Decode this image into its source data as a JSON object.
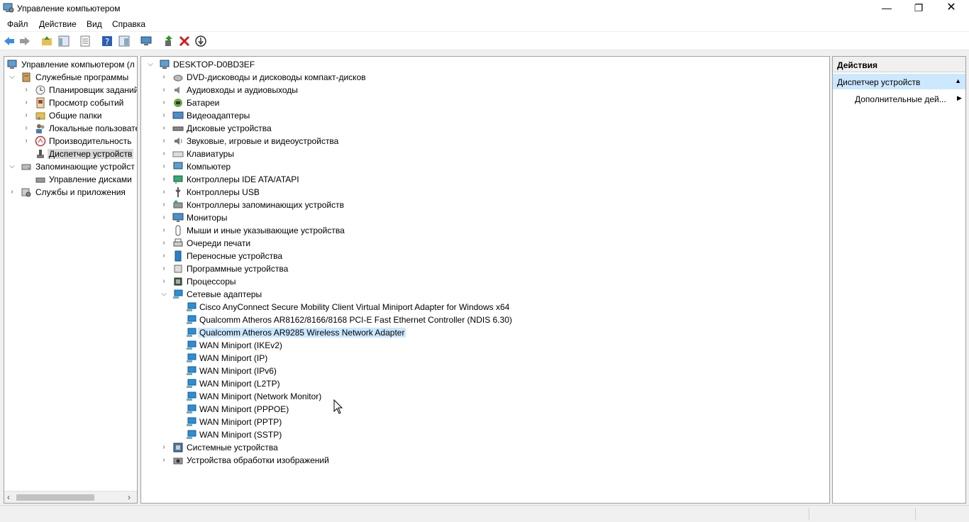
{
  "window": {
    "title": "Управление компьютером",
    "min_glyph": "—",
    "max_glyph": "❐",
    "close_glyph": "✕"
  },
  "menu": [
    "Файл",
    "Действие",
    "Вид",
    "Справка"
  ],
  "toolbar": [
    "back-arrow-icon",
    "forward-arrow-icon",
    "up-folder-icon",
    "show-hide-tree-icon",
    "properties-icon",
    "help-icon",
    "details-view-icon",
    "monitor-icon",
    "update-driver-icon",
    "uninstall-icon",
    "disable-device-icon"
  ],
  "left_tree": {
    "root": "Управление компьютером (л",
    "items": [
      {
        "label": "Служебные программы",
        "level": 1,
        "expanded": true
      },
      {
        "label": "Планировщик заданий",
        "level": 2
      },
      {
        "label": "Просмотр событий",
        "level": 2
      },
      {
        "label": "Общие папки",
        "level": 2
      },
      {
        "label": "Локальные пользовате",
        "level": 2
      },
      {
        "label": "Производительность",
        "level": 2
      },
      {
        "label": "Диспетчер устройств",
        "level": 2,
        "selected": true
      },
      {
        "label": "Запоминающие устройст",
        "level": 1,
        "expanded": true
      },
      {
        "label": "Управление дисками",
        "level": 2
      },
      {
        "label": "Службы и приложения",
        "level": 1
      }
    ]
  },
  "device_tree": {
    "root": "DESKTOP-D0BD3EF",
    "categories": [
      "DVD-дисководы и дисководы компакт-дисков",
      "Аудиовходы и аудиовыходы",
      "Батареи",
      "Видеоадаптеры",
      "Дисковые устройства",
      "Звуковые, игровые и видеоустройства",
      "Клавиатуры",
      "Компьютер",
      "Контроллеры IDE ATA/ATAPI",
      "Контроллеры USB",
      "Контроллеры запоминающих устройств",
      "Мониторы",
      "Мыши и иные указывающие устройства",
      "Очереди печати",
      "Переносные устройства",
      "Программные устройства",
      "Процессоры"
    ],
    "network": {
      "label": "Сетевые адаптеры",
      "children": [
        "Cisco AnyConnect Secure Mobility Client Virtual Miniport Adapter for Windows x64",
        "Qualcomm Atheros AR8162/8166/8168 PCI-E Fast Ethernet Controller (NDIS 6.30)",
        "Qualcomm Atheros AR9285 Wireless Network Adapter",
        "WAN Miniport (IKEv2)",
        "WAN Miniport (IP)",
        "WAN Miniport (IPv6)",
        "WAN Miniport (L2TP)",
        "WAN Miniport (Network Monitor)",
        "WAN Miniport (PPPOE)",
        "WAN Miniport (PPTP)",
        "WAN Miniport (SSTP)"
      ],
      "highlighted_index": 2
    },
    "after": [
      "Системные устройства",
      "Устройства обработки изображений"
    ]
  },
  "actions": {
    "header": "Действия",
    "section": "Диспетчер устройств",
    "item": "Дополнительные дей..."
  },
  "colors": {
    "selection": "#cce8ff",
    "inactive_selection": "#d9d9d9",
    "net_icon": "#2a8fd8"
  }
}
